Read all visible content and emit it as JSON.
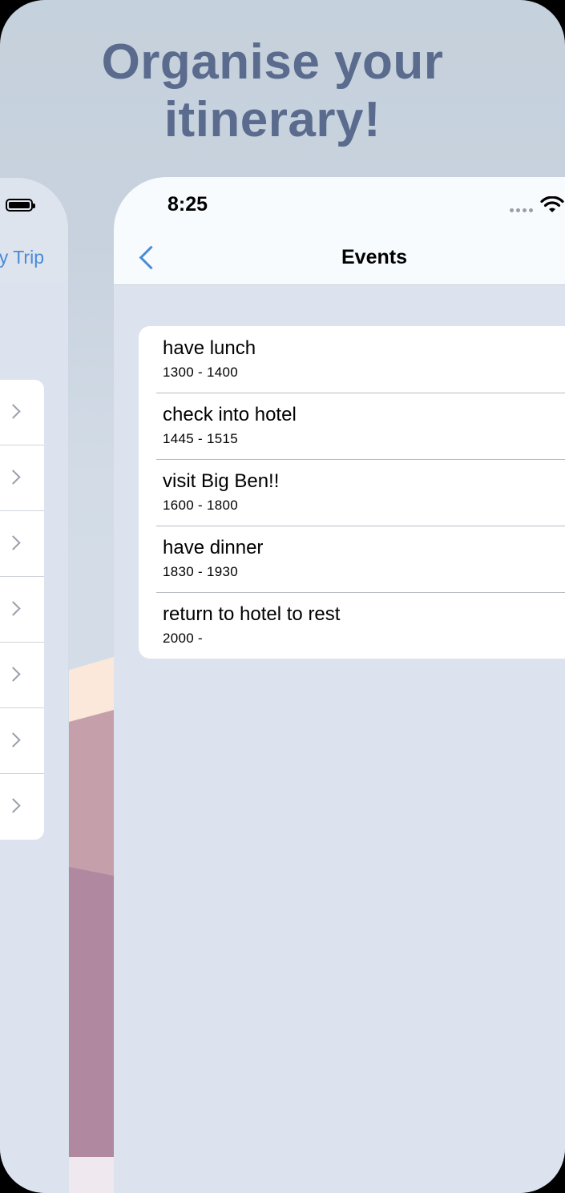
{
  "headline": "Organise your itinerary!",
  "left_screen": {
    "nav_link_label": "y Trip",
    "rows": [
      "",
      "",
      "",
      "",
      "",
      "",
      ""
    ]
  },
  "status_bar": {
    "time": "8:25"
  },
  "nav": {
    "title": "Events",
    "back_icon": "chevron-left-icon"
  },
  "events": [
    {
      "title": "have lunch",
      "time": "1300 - 1400"
    },
    {
      "title": "check into hotel",
      "time": "1445 - 1515"
    },
    {
      "title": "visit Big Ben!!",
      "time": "1600 - 1800"
    },
    {
      "title": "have dinner",
      "time": "1830 - 1930"
    },
    {
      "title": "return to hotel to rest",
      "time": "2000 -"
    }
  ],
  "colors": {
    "accent": "#4a8bd6",
    "headline": "#5a6b8e",
    "background": "#dce3ee"
  }
}
